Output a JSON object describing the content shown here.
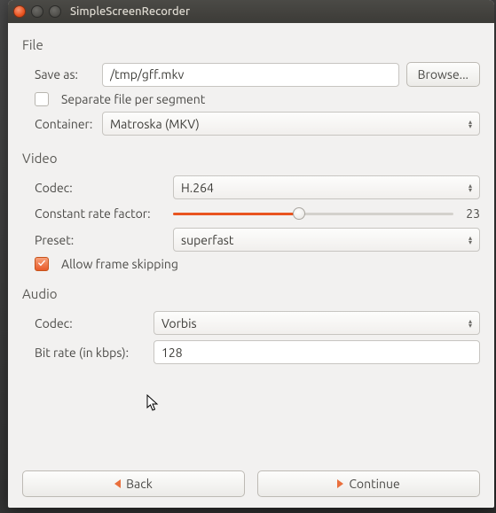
{
  "window": {
    "title": "SimpleScreenRecorder"
  },
  "file": {
    "section": "File",
    "save_as_label": "Save as:",
    "save_as_value": "/tmp/gff.mkv",
    "browse_label": "Browse...",
    "separate_checkbox_checked": false,
    "separate_label": "Separate file per segment",
    "container_label": "Container:",
    "container_value": "Matroska (MKV)"
  },
  "video": {
    "section": "Video",
    "codec_label": "Codec:",
    "codec_value": "H.264",
    "crf_label": "Constant rate factor:",
    "crf_value": "23",
    "crf_percent": 45,
    "preset_label": "Preset:",
    "preset_value": "superfast",
    "skip_checkbox_checked": true,
    "skip_label": "Allow frame skipping"
  },
  "audio": {
    "section": "Audio",
    "codec_label": "Codec:",
    "codec_value": "Vorbis",
    "bitrate_label": "Bit rate (in kbps):",
    "bitrate_value": "128"
  },
  "footer": {
    "back_label": "Back",
    "continue_label": "Continue"
  }
}
